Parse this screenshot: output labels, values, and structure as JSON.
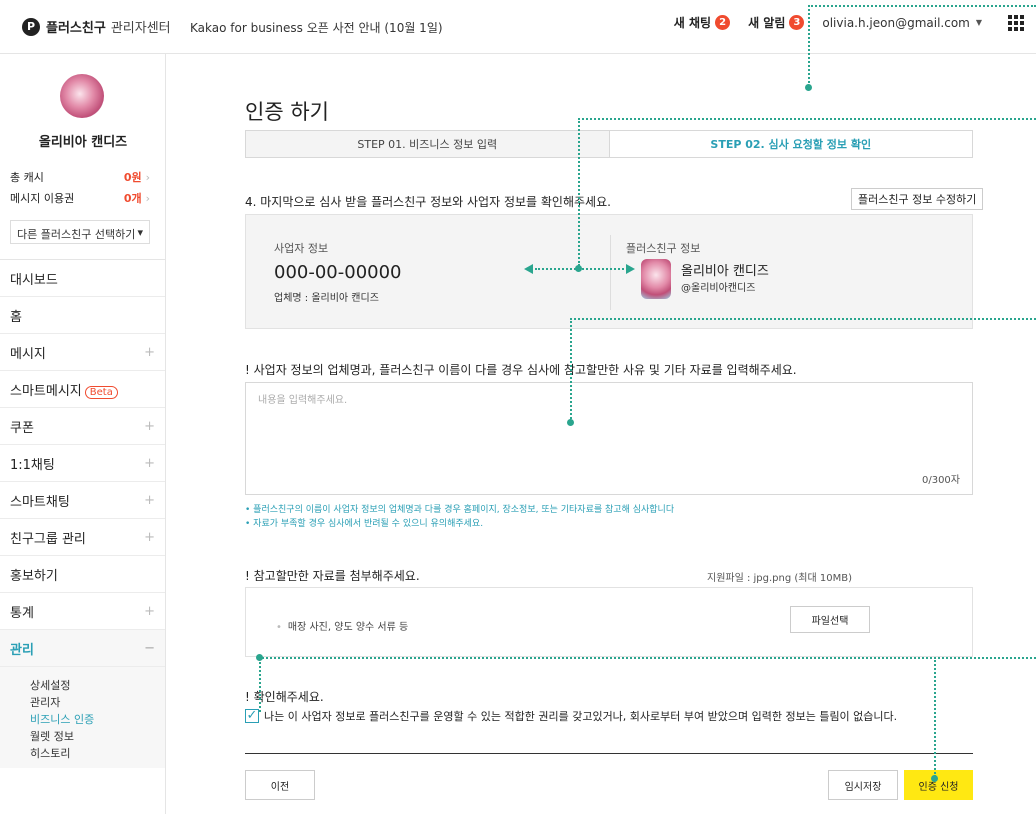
{
  "header": {
    "logo_mark": "P",
    "logo_name": "플러스친구",
    "logo_sub": "관리자센터",
    "notice": "Kakao for business 오픈 사전 안내 (10월 1일)",
    "new_chat_label": "새 채팅",
    "new_chat_count": "2",
    "new_alert_label": "새 알림",
    "new_alert_count": "3",
    "email": "olivia.h.jeon@gmail.com"
  },
  "sidebar": {
    "profile_name": "올리비아 캔디즈",
    "cash_label": "총 캐시",
    "cash_value": "0원",
    "msg_label": "메시지 이용권",
    "msg_value": "0개",
    "select_friend": "다른 플러스친구 선택하기",
    "menu": [
      {
        "label": "대시보드"
      },
      {
        "label": "홈"
      },
      {
        "label": "메시지"
      },
      {
        "label": "스마트메시지",
        "badge": "Beta"
      },
      {
        "label": "쿠폰"
      },
      {
        "label": "1:1채팅"
      },
      {
        "label": "스마트채팅"
      },
      {
        "label": "친구그룹 관리"
      },
      {
        "label": "홍보하기"
      },
      {
        "label": "통계"
      },
      {
        "label": "관리"
      }
    ],
    "submenu": [
      "상세설정",
      "관리자",
      "비즈니스 인증",
      "월렛 정보",
      "히스토리"
    ]
  },
  "main": {
    "title": "인증 하기",
    "step1": "STEP 01. 비즈니스 정보 입력",
    "step2": "STEP 02. 심사 요청할 정보 확인",
    "section4": "4. 마지막으로 심사 받을 플러스친구 정보와 사업자 정보를 확인해주세요.",
    "edit_button": "플러스친구 정보 수정하기",
    "biz_label": "사업자 정보",
    "biz_number": "000-00-00000",
    "biz_company": "업체명 : 올리비아 캔디즈",
    "pf_label": "플러스친구 정보",
    "pf_name": "올리비아 캔디즈",
    "pf_id": "@올리비아캔디즈",
    "reason_title": "! 사업자 정보의 업체명과, 플러스친구 이름이 다를 경우 심사에 참고할만한 사유 및 기타 자료를 입력해주세요.",
    "reason_placeholder": "내용을 입력해주세요.",
    "reason_count": "0/300자",
    "note1": "• 플러스친구의 이름이 사업자 정보의 업체명과 다를 경우 홈페이지, 장소정보, 또는 기타자료를 참고해 심사합니다",
    "note2": "• 자료가 부족할 경우 심사에서 반려될 수 있으니 유의해주세요.",
    "attach_title": "! 참고할만한 자료를 첨부해주세요.",
    "attach_types": "지원파일 : jpg.png (최대 10MB)",
    "attach_hint": "매장 사진, 양도 양수 서류 등",
    "file_button": "파일선택",
    "confirm_title": "! 확인해주세요.",
    "confirm_text": "나는 이 사업자 정보로 플러스친구를 운영할 수 있는 적합한 권리를 갖고있거나, 회사로부터 부여 받았으며 입력한 정보는 틀림이 없습니다.",
    "prev_button": "이전",
    "draft_button": "임시저장",
    "submit_button": "인증 신청"
  },
  "colors": {
    "accent": "#2a9fb5",
    "badge": "#f04b2f",
    "submit": "#ffe812",
    "annotation": "#2aa58e"
  }
}
